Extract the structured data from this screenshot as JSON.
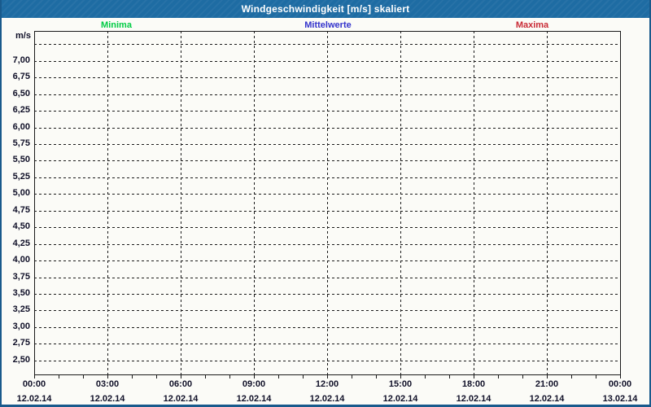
{
  "window": {
    "title": "Windgeschwindigkeit [m/s] skaliert"
  },
  "legend": {
    "items": [
      {
        "label": "Minima",
        "color": "#00cc44"
      },
      {
        "label": "Mittelwerte",
        "color": "#3333cc"
      },
      {
        "label": "Maxima",
        "color": "#c92a35"
      }
    ]
  },
  "y_axis": {
    "unit": "m/s",
    "ticks": [
      {
        "value": 7.25,
        "label": ""
      },
      {
        "value": 7.0,
        "label": "7,00"
      },
      {
        "value": 6.75,
        "label": "6,75"
      },
      {
        "value": 6.5,
        "label": "6,50"
      },
      {
        "value": 6.25,
        "label": "6,25"
      },
      {
        "value": 6.0,
        "label": "6,00"
      },
      {
        "value": 5.75,
        "label": "5,75"
      },
      {
        "value": 5.5,
        "label": "5,50"
      },
      {
        "value": 5.25,
        "label": "5,25"
      },
      {
        "value": 5.0,
        "label": "5,00"
      },
      {
        "value": 4.75,
        "label": "4,75"
      },
      {
        "value": 4.5,
        "label": "4,50"
      },
      {
        "value": 4.25,
        "label": "4,25"
      },
      {
        "value": 4.0,
        "label": "4,00"
      },
      {
        "value": 3.75,
        "label": "3,75"
      },
      {
        "value": 3.5,
        "label": "3,50"
      },
      {
        "value": 3.25,
        "label": "3,25"
      },
      {
        "value": 3.0,
        "label": "3,00"
      },
      {
        "value": 2.75,
        "label": "2,75"
      },
      {
        "value": 2.5,
        "label": "2,50"
      }
    ]
  },
  "x_axis": {
    "range_hours": [
      0,
      24
    ],
    "minor_tick_step_hours": 1,
    "major_ticks": [
      {
        "hours": 0,
        "time": "00:00",
        "date": "12.02.14"
      },
      {
        "hours": 3,
        "time": "03:00",
        "date": "12.02.14"
      },
      {
        "hours": 6,
        "time": "06:00",
        "date": "12.02.14"
      },
      {
        "hours": 9,
        "time": "09:00",
        "date": "12.02.14"
      },
      {
        "hours": 12,
        "time": "12:00",
        "date": "12.02.14"
      },
      {
        "hours": 15,
        "time": "15:00",
        "date": "12.02.14"
      },
      {
        "hours": 18,
        "time": "18:00",
        "date": "12.02.14"
      },
      {
        "hours": 21,
        "time": "21:00",
        "date": "12.02.14"
      },
      {
        "hours": 24,
        "time": "00:00",
        "date": "13.02.14"
      }
    ]
  },
  "chart_data": {
    "type": "line",
    "title": "Windgeschwindigkeit [m/s] skaliert",
    "xlabel": "",
    "ylabel": "m/s",
    "ylim": [
      2.29,
      7.45
    ],
    "x_range": [
      "12.02.14 00:00",
      "13.02.14 00:00"
    ],
    "grid": true,
    "grid_style": "dashed",
    "legend_position": "top",
    "categories": [],
    "series": [
      {
        "name": "Minima",
        "color": "#00cc44",
        "values": []
      },
      {
        "name": "Mittelwerte",
        "color": "#3333cc",
        "values": []
      },
      {
        "name": "Maxima",
        "color": "#c92a35",
        "values": []
      }
    ]
  }
}
